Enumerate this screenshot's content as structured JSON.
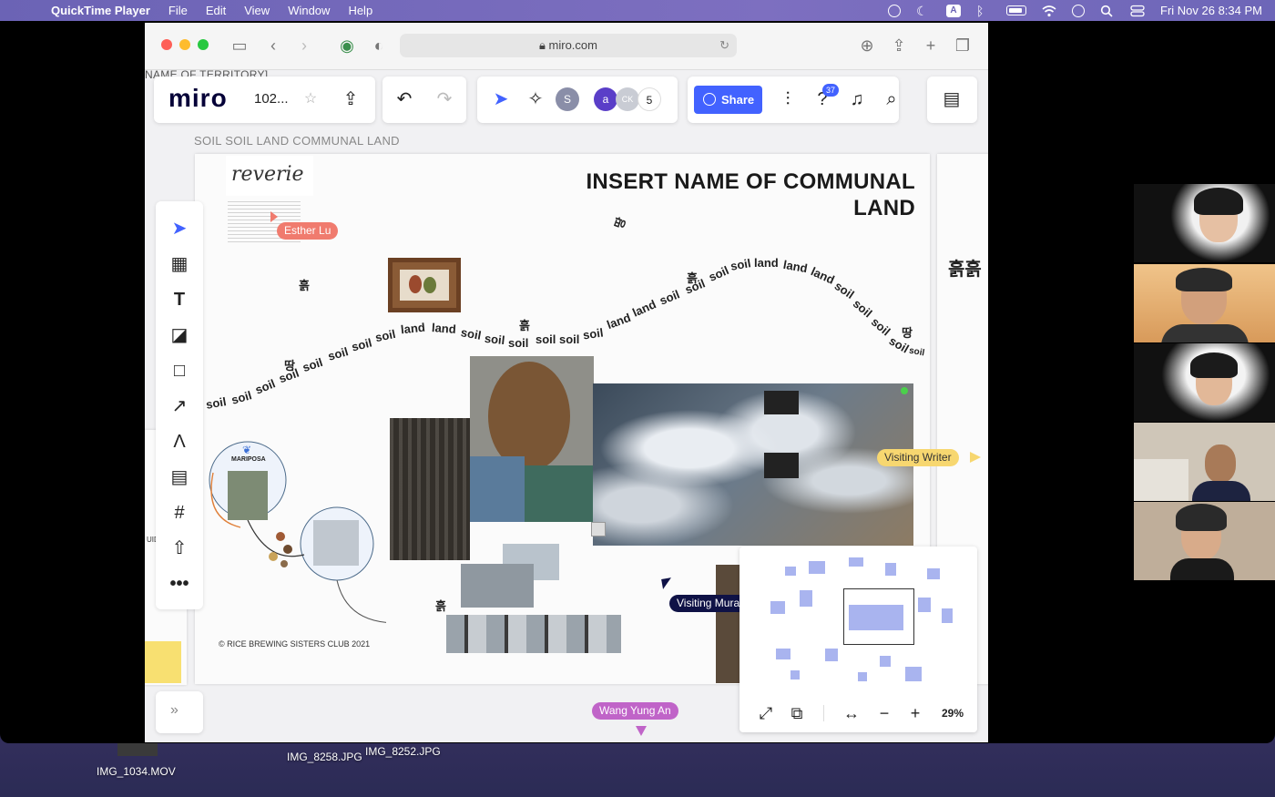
{
  "menubar": {
    "app": "QuickTime Player",
    "menus": [
      "File",
      "Edit",
      "View",
      "Window",
      "Help"
    ],
    "status_letter": "A",
    "datetime": "Fri Nov 26  8:34 PM"
  },
  "browser": {
    "url": "miro.com"
  },
  "miro": {
    "logo": "miro",
    "board_name": "102...",
    "collaborator_count": "5",
    "avatars": [
      "S",
      "a",
      "CK"
    ],
    "share_label": "Share",
    "notification_badge": "37",
    "zoom": "29%"
  },
  "board": {
    "frame_label_top": "NAME OF TERRITORY]",
    "frame_label": "SOIL SOIL LAND COMMUNAL LAND",
    "title": "INSERT NAME OF COMMUNAL LAND",
    "signature": "reverie",
    "mariposa_label": "MARIPOSA",
    "copyright": "© RICE BREWING SISTERS CLUB 2021",
    "left_fragment_1": "UID",
    "hangul_heuk": "흙",
    "hangul_ttang": "땅",
    "hangul_large": "흙흙"
  },
  "cursors": {
    "esther": "Esther Lu",
    "writer": "Visiting Writer",
    "mural": "Visiting Mura",
    "wang": "Wang Yung An"
  },
  "desktop": {
    "files": [
      "IMG_1034.MOV",
      "IMG_8258.JPG",
      "IMG_8252.JPG"
    ]
  },
  "colors": {
    "miro_blue": "#4262ff",
    "esther": "#f07b6e",
    "writer": "#f7d770",
    "mural": "#0f1246",
    "wang": "#c064c8"
  }
}
